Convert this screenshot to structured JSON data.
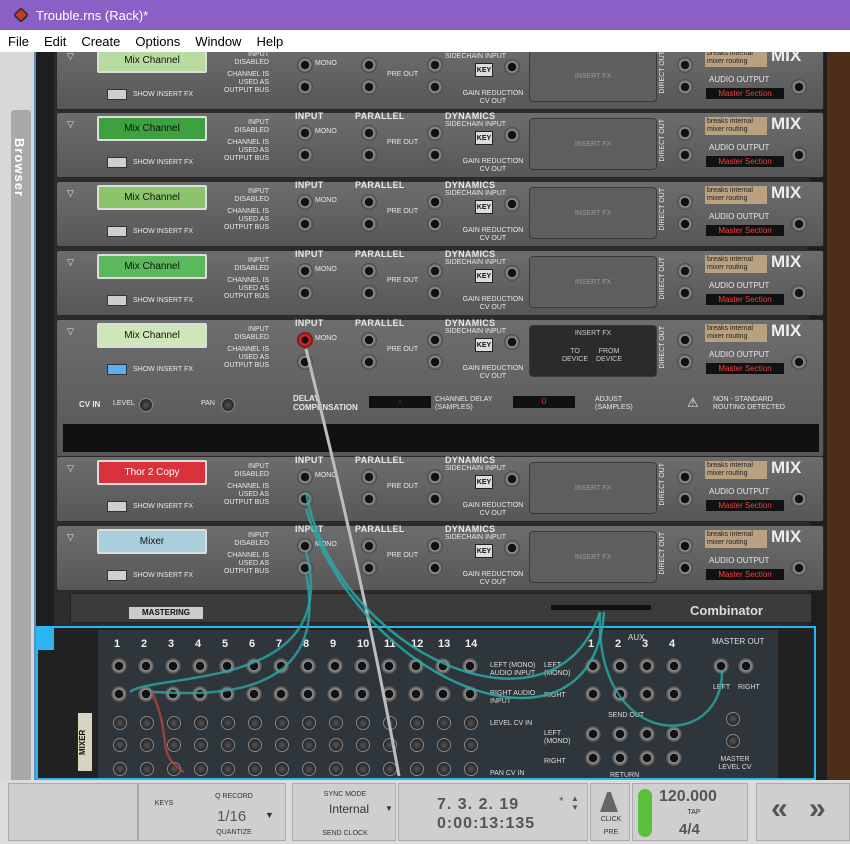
{
  "window": {
    "title": "Trouble.rns (Rack)*"
  },
  "menu": [
    "File",
    "Edit",
    "Create",
    "Options",
    "Window",
    "Help"
  ],
  "sidebar": {
    "label": "Browser"
  },
  "strip": {
    "input": "INPUT",
    "parallel": "PARALLEL",
    "dynamics": "DYNAMICS",
    "sidechain": "SIDECHAIN INPUT",
    "input_disabled": "INPUT DISABLED",
    "channel_used": "CHANNEL IS USED AS OUTPUT BUS",
    "mono": "MONO",
    "l": "L",
    "r": "R",
    "pre_out": "PRE OUT",
    "key": "KEY",
    "gain_reduction": "GAIN REDUCTION CV OUT",
    "insert_fx": "INSERT FX",
    "show_insert_fx": "SHOW INSERT FX",
    "direct_out": "DIRECT OUT",
    "breaks": "breaks internal mixer routing",
    "mix": "MIX",
    "audio_output": "AUDIO OUTPUT",
    "master_section": "Master Section"
  },
  "channels": [
    {
      "name": "Mix Channel",
      "color": "#b8dca0"
    },
    {
      "name": "Mix Channel",
      "color": "#3fa03f"
    },
    {
      "name": "Mix Channel",
      "color": "#8bc46a"
    },
    {
      "name": "Mix Channel",
      "color": "#5cb85c"
    },
    {
      "name": "Mix Channel",
      "color": "#cfe6b8"
    },
    {
      "name": "Thor 2 Copy",
      "color": "#d9323a"
    },
    {
      "name": "Mixer",
      "color": "#a9cfdc"
    }
  ],
  "expanded": {
    "cv_in": "CV IN",
    "level": "LEVEL",
    "pan": "PAN",
    "delay_comp": "DELAY COMPENSATION",
    "channel_delay": "CHANNEL DELAY (SAMPLES)",
    "delay_value": "-",
    "adjust_value": "0",
    "adjust": "ADJUST (SAMPLES)",
    "non_standard": "NON - STANDARD ROUTING DETECTED",
    "to_device": "TO DEVICE",
    "from_device": "FROM DEVICE"
  },
  "combinator": {
    "patch": "MASTERING",
    "name": "Combinator"
  },
  "mixer14": {
    "channels": [
      "1",
      "2",
      "3",
      "4",
      "5",
      "6",
      "7",
      "8",
      "9",
      "10",
      "11",
      "12",
      "13",
      "14"
    ],
    "left_input": "LEFT (MONO) AUDIO INPUT",
    "right_input": "RIGHT AUDIO INPUT",
    "level_cv": "LEVEL CV IN",
    "pan_cv": "PAN CV IN",
    "aux": "AUX",
    "aux_nums": [
      "1",
      "2",
      "3",
      "4"
    ],
    "send_out": "SEND OUT",
    "return": "RETURN",
    "left_mono": "LEFT (MONO)",
    "right": "RIGHT",
    "master_out": "MASTER OUT",
    "left": "LEFT",
    "master_level_cv": "MASTER LEVEL CV",
    "side_label": "MIXER"
  },
  "transport": {
    "keys": "KEYS",
    "q_record": "Q RECORD",
    "quantize_value": "1/16",
    "quantize": "QUANTIZE",
    "sync_mode": "SYNC MODE",
    "sync_value": "Internal",
    "send_clock": "SEND CLOCK",
    "position": "7.  3.  2.  19",
    "star": "*",
    "time": "0:00:13:135",
    "click": "CLICK",
    "pre": "PRE",
    "tempo": "120.000",
    "tap": "TAP",
    "signature": "4/4",
    "rewind": "«",
    "forward": "»"
  }
}
